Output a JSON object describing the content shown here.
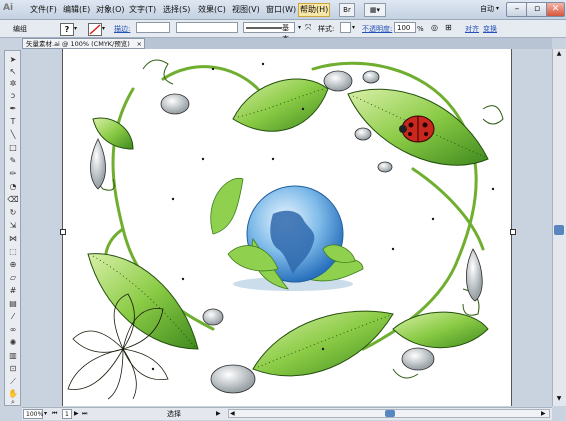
{
  "app": {
    "logo": "Ai"
  },
  "menu": [
    "文件(F)",
    "编辑(E)",
    "对象(O)",
    "文字(T)",
    "选择(S)",
    "效果(C)",
    "视图(V)",
    "窗口(W)",
    "帮助(H)"
  ],
  "title_right": "自动",
  "control_bar": {
    "group_label": "编组",
    "stroke_label": "描边:",
    "stroke_style": "基本",
    "style_label": "样式:",
    "opacity_label": "不透明度:",
    "opacity_value": "100",
    "opacity_unit": "%",
    "align_link": "对齐",
    "transform_link": "变换"
  },
  "document_tab": {
    "label": "矢量素材.ai @ 100% (CMYK/预览)",
    "close": "×"
  },
  "status_bar": {
    "zoom": "100%",
    "page": "1",
    "tool": "选择"
  },
  "colors": {
    "leaf": "#7cc242",
    "leaf_dark": "#3f7f1d",
    "globe_blue": "#3d8ed6",
    "ladybug": "#c8281e",
    "menubar": "#c4d1e2"
  }
}
